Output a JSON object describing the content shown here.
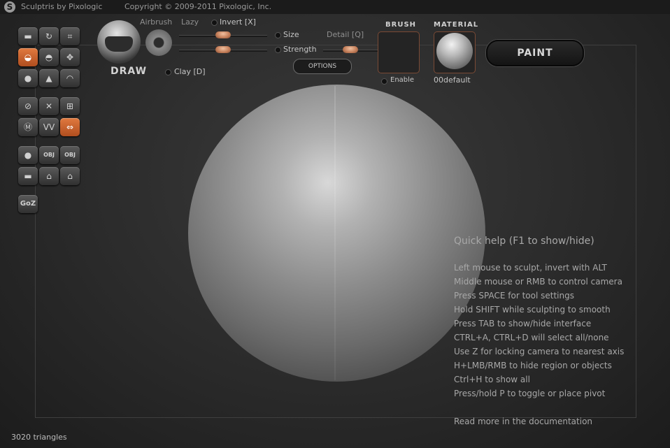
{
  "titlebar": {
    "logo_glyph": "S",
    "app_title": "Sculptris by Pixologic",
    "copyright": "Copyright © 2009-2011 Pixologic, Inc."
  },
  "tools": {
    "items": [
      {
        "name": "tool-crop-icon"
      },
      {
        "name": "tool-rotate-icon"
      },
      {
        "name": "tool-scale-frame-icon"
      },
      {
        "name": "tool-draw-icon"
      },
      {
        "name": "tool-flatten-icon"
      },
      {
        "name": "tool-move-icon"
      },
      {
        "name": "tool-grab-icon"
      },
      {
        "name": "tool-inflate-icon"
      },
      {
        "name": "tool-smooth-icon"
      },
      {
        "name": "tool-symmetry-icon"
      },
      {
        "name": "tool-wireframe-icon"
      },
      {
        "name": "tool-grid-icon"
      },
      {
        "name": "tool-mask-icon"
      },
      {
        "name": "tool-pinch-icon"
      },
      {
        "name": "tool-mirror-icon"
      },
      {
        "name": "tool-sphere-icon"
      },
      {
        "name": "tool-import-obj-icon"
      },
      {
        "name": "tool-export-obj-icon"
      },
      {
        "name": "tool-plane-icon"
      },
      {
        "name": "tool-save-icon"
      },
      {
        "name": "tool-save-as-icon"
      }
    ],
    "obj_label": "OBJ",
    "goz_label": "GoZ",
    "active_color": "#d8693a"
  },
  "brush": {
    "draw_label": "DRAW",
    "airbrush_label": "Airbrush",
    "lazy_label": "Lazy",
    "invert_label": "Invert [X]",
    "clay_label": "Clay [D]",
    "size_label": "Size",
    "strength_label": "Strength",
    "detail_label": "Detail [Q]",
    "options_label": "OPTIONS",
    "size_value": 0.5,
    "strength_value": 0.5,
    "detail_value": 0.5
  },
  "brush_panel": {
    "header": "BRUSH",
    "enable_label": "Enable"
  },
  "material_panel": {
    "header": "MATERIAL",
    "material_name": "00default"
  },
  "paint_button": "PAINT",
  "quick_help": {
    "title": "Quick help (F1 to show/hide)",
    "lines": [
      "Left mouse to sculpt, invert with ALT",
      "Middle mouse or RMB to control camera",
      "Press SPACE for tool settings",
      "Hold SHIFT while sculpting to smooth",
      "Press TAB to show/hide interface",
      "CTRL+A, CTRL+D will select all/none",
      "Use Z for locking camera to nearest axis",
      "H+LMB/RMB to hide region or objects",
      "Ctrl+H to show all",
      "Press/hold P to toggle or place pivot"
    ],
    "documentation_link": "Read more in the documentation"
  },
  "status": {
    "triangle_count": "3020 triangles"
  }
}
